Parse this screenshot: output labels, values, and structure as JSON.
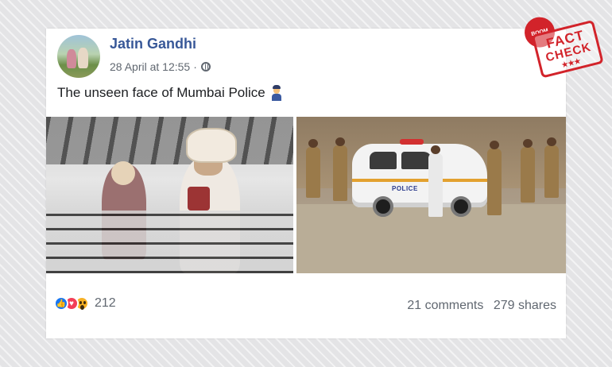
{
  "post": {
    "author": "Jatin Gandhi",
    "date": "28 April at 12:55",
    "separator": "·",
    "text": "The unseen face of Mumbai Police",
    "text_emoji": "police-officer-emoji"
  },
  "photos": {
    "left_alt": "wedding-couple-balcony-photo",
    "right_car_label": "POLICE"
  },
  "footer": {
    "reaction_icons": [
      "like-icon",
      "love-icon",
      "wow-icon"
    ],
    "reaction_count": "212",
    "comments": "21 comments",
    "shares": "279 shares"
  },
  "stamp": {
    "brand": "BOOM",
    "line1": "FACT",
    "line2": "CHECK",
    "stars": "★★★",
    "color": "#d2232a"
  },
  "colors": {
    "author_link": "#385898",
    "secondary_text": "#606770",
    "like": "#1877f2",
    "love": "#f33e58",
    "wow": "#f7b125"
  }
}
